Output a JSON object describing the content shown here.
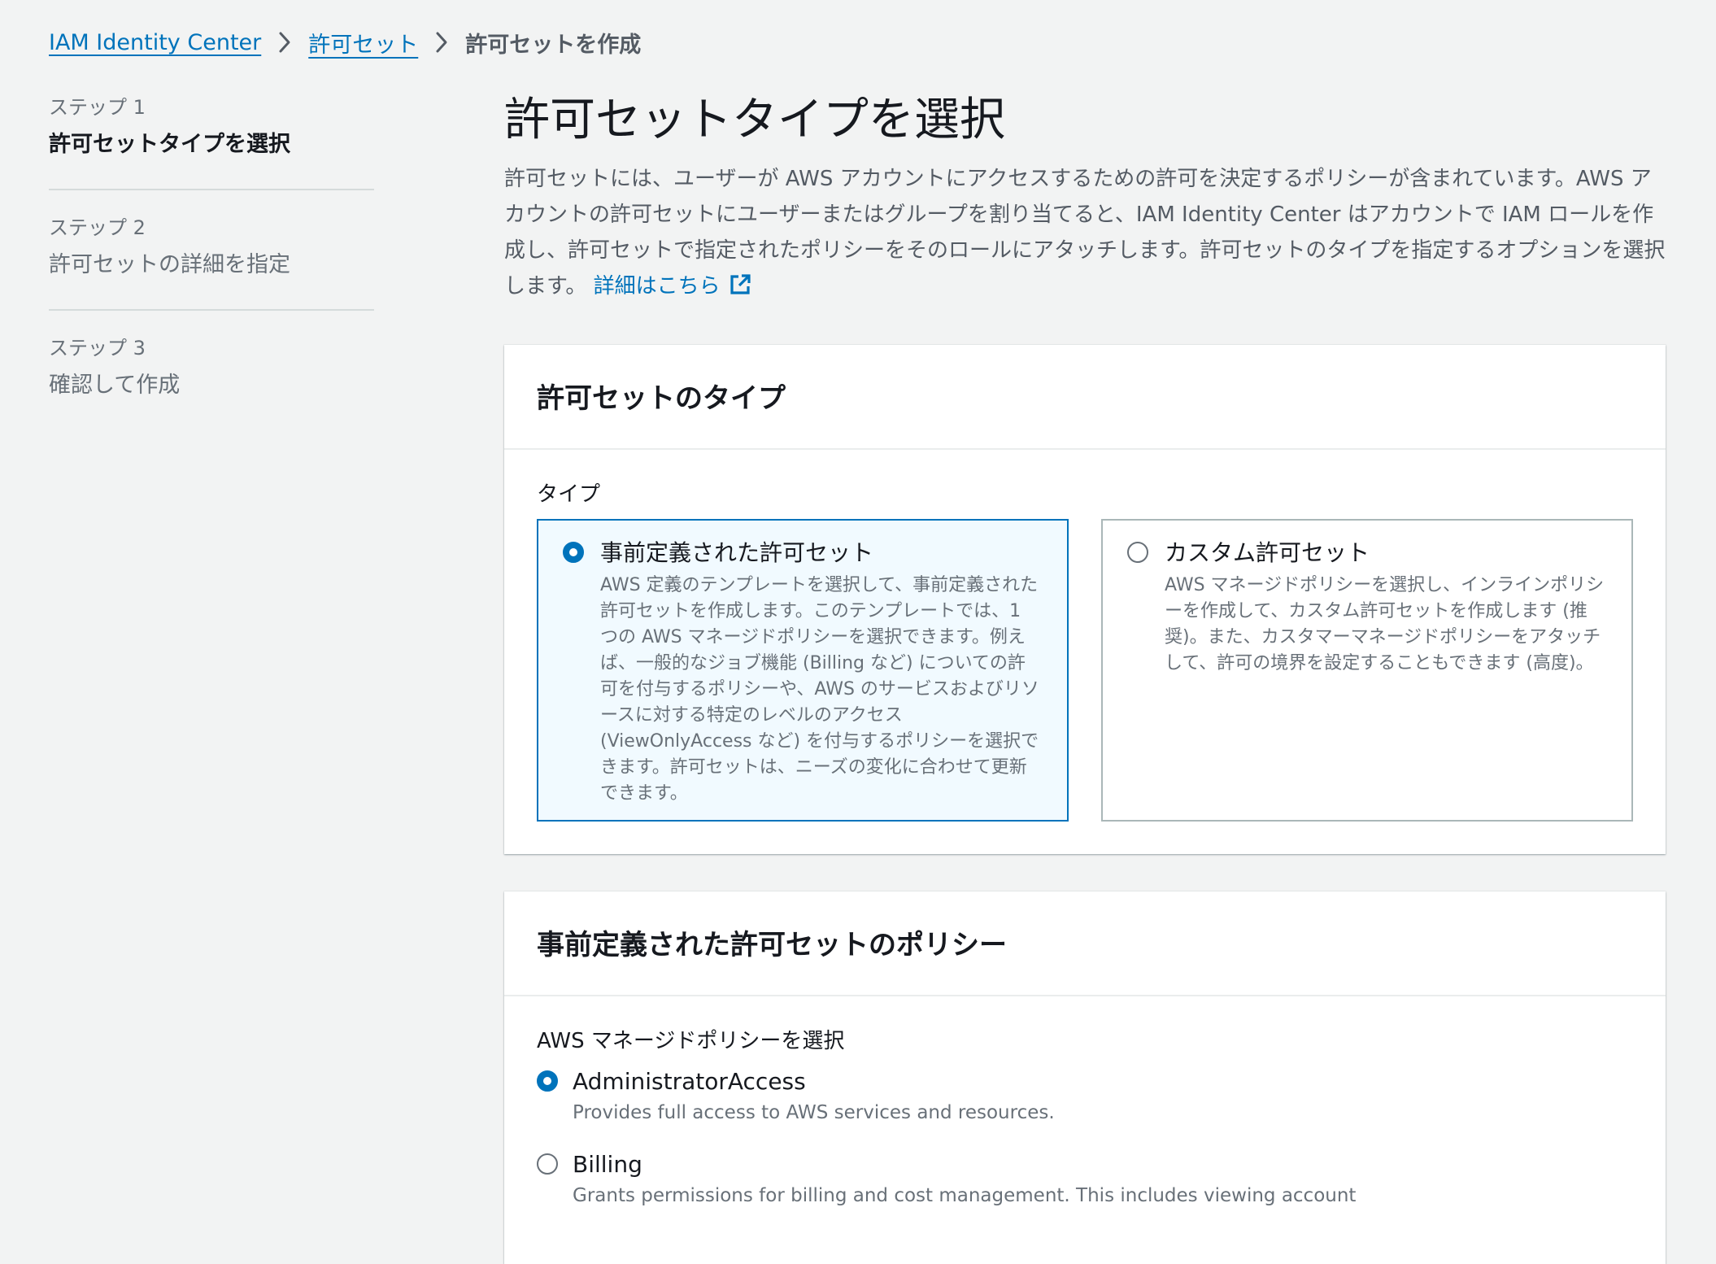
{
  "breadcrumb": {
    "items": [
      "IAM Identity Center",
      "許可セット"
    ],
    "current": "許可セットを作成"
  },
  "steps": [
    {
      "num": "ステップ 1",
      "title": "許可セットタイプを選択",
      "active": true
    },
    {
      "num": "ステップ 2",
      "title": "許可セットの詳細を指定",
      "active": false
    },
    {
      "num": "ステップ 3",
      "title": "確認して作成",
      "active": false
    }
  ],
  "page": {
    "title": "許可セットタイプを選択",
    "description": "許可セットには、ユーザーが AWS アカウントにアクセスするための許可を決定するポリシーが含まれています。AWS アカウントの許可セットにユーザーまたはグループを割り当てると、IAM Identity Center はアカウントで IAM ロールを作成し、許可セットで指定されたポリシーをそのロールにアタッチします。許可セットのタイプを指定するオプションを選択します。",
    "learn_more": "詳細はこちら"
  },
  "type_panel": {
    "header": "許可セットのタイプ",
    "field_label": "タイプ",
    "tiles": [
      {
        "title": "事前定義された許可セット",
        "description": "AWS 定義のテンプレートを選択して、事前定義された許可セットを作成します。このテンプレートでは、1 つの AWS マネージドポリシーを選択できます。例えば、一般的なジョブ機能 (Billing など) についての許可を付与するポリシーや、AWS のサービスおよびリソースに対する特定のレベルのアクセス (ViewOnlyAccess など) を付与するポリシーを選択できます。許可セットは、ニーズの変化に合わせて更新できます。",
        "selected": true
      },
      {
        "title": "カスタム許可セット",
        "description": "AWS マネージドポリシーを選択し、インラインポリシーを作成して、カスタム許可セットを作成します (推奨)。また、カスタマーマネージドポリシーをアタッチして、許可の境界を設定することもできます (高度)。",
        "selected": false
      }
    ]
  },
  "policy_panel": {
    "header": "事前定義された許可セットのポリシー",
    "field_label": "AWS マネージドポリシーを選択",
    "options": [
      {
        "title": "AdministratorAccess",
        "description": "Provides full access to AWS services and resources.",
        "selected": true
      },
      {
        "title": "Billing",
        "description": "Grants permissions for billing and cost management. This includes viewing account",
        "selected": false
      }
    ]
  },
  "colors": {
    "link": "#0073bb",
    "selected_border": "#0073bb",
    "selected_bg": "#f1faff",
    "background": "#f2f3f3"
  }
}
